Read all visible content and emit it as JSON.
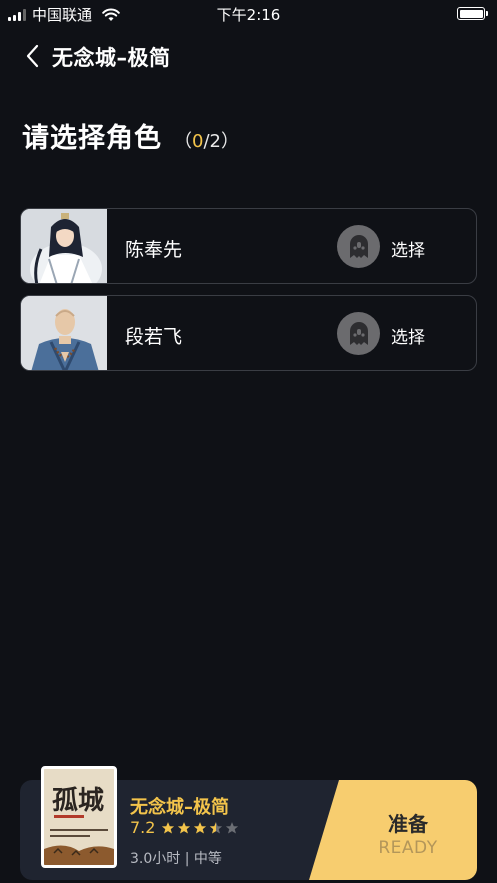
{
  "status_bar": {
    "carrier": "中国联通",
    "time": "下午2:16"
  },
  "nav": {
    "title": "无念城–极简"
  },
  "heading": {
    "title": "请选择角色",
    "count_open": "（",
    "count_selected": "0",
    "count_total": "/2）"
  },
  "roles": [
    {
      "name": "陈奉先",
      "action": "选择"
    },
    {
      "name": "段若飞",
      "action": "选择"
    }
  ],
  "game": {
    "title": "无念城–极简",
    "rating": "7.2",
    "meta": "3.0小时 | 中等",
    "cover_text": "孤城"
  },
  "ready": {
    "label_cn": "准备",
    "label_en": "READY"
  },
  "colors": {
    "accent": "#f3c44b",
    "background": "#0f1116",
    "button": "#f7cd6f"
  }
}
